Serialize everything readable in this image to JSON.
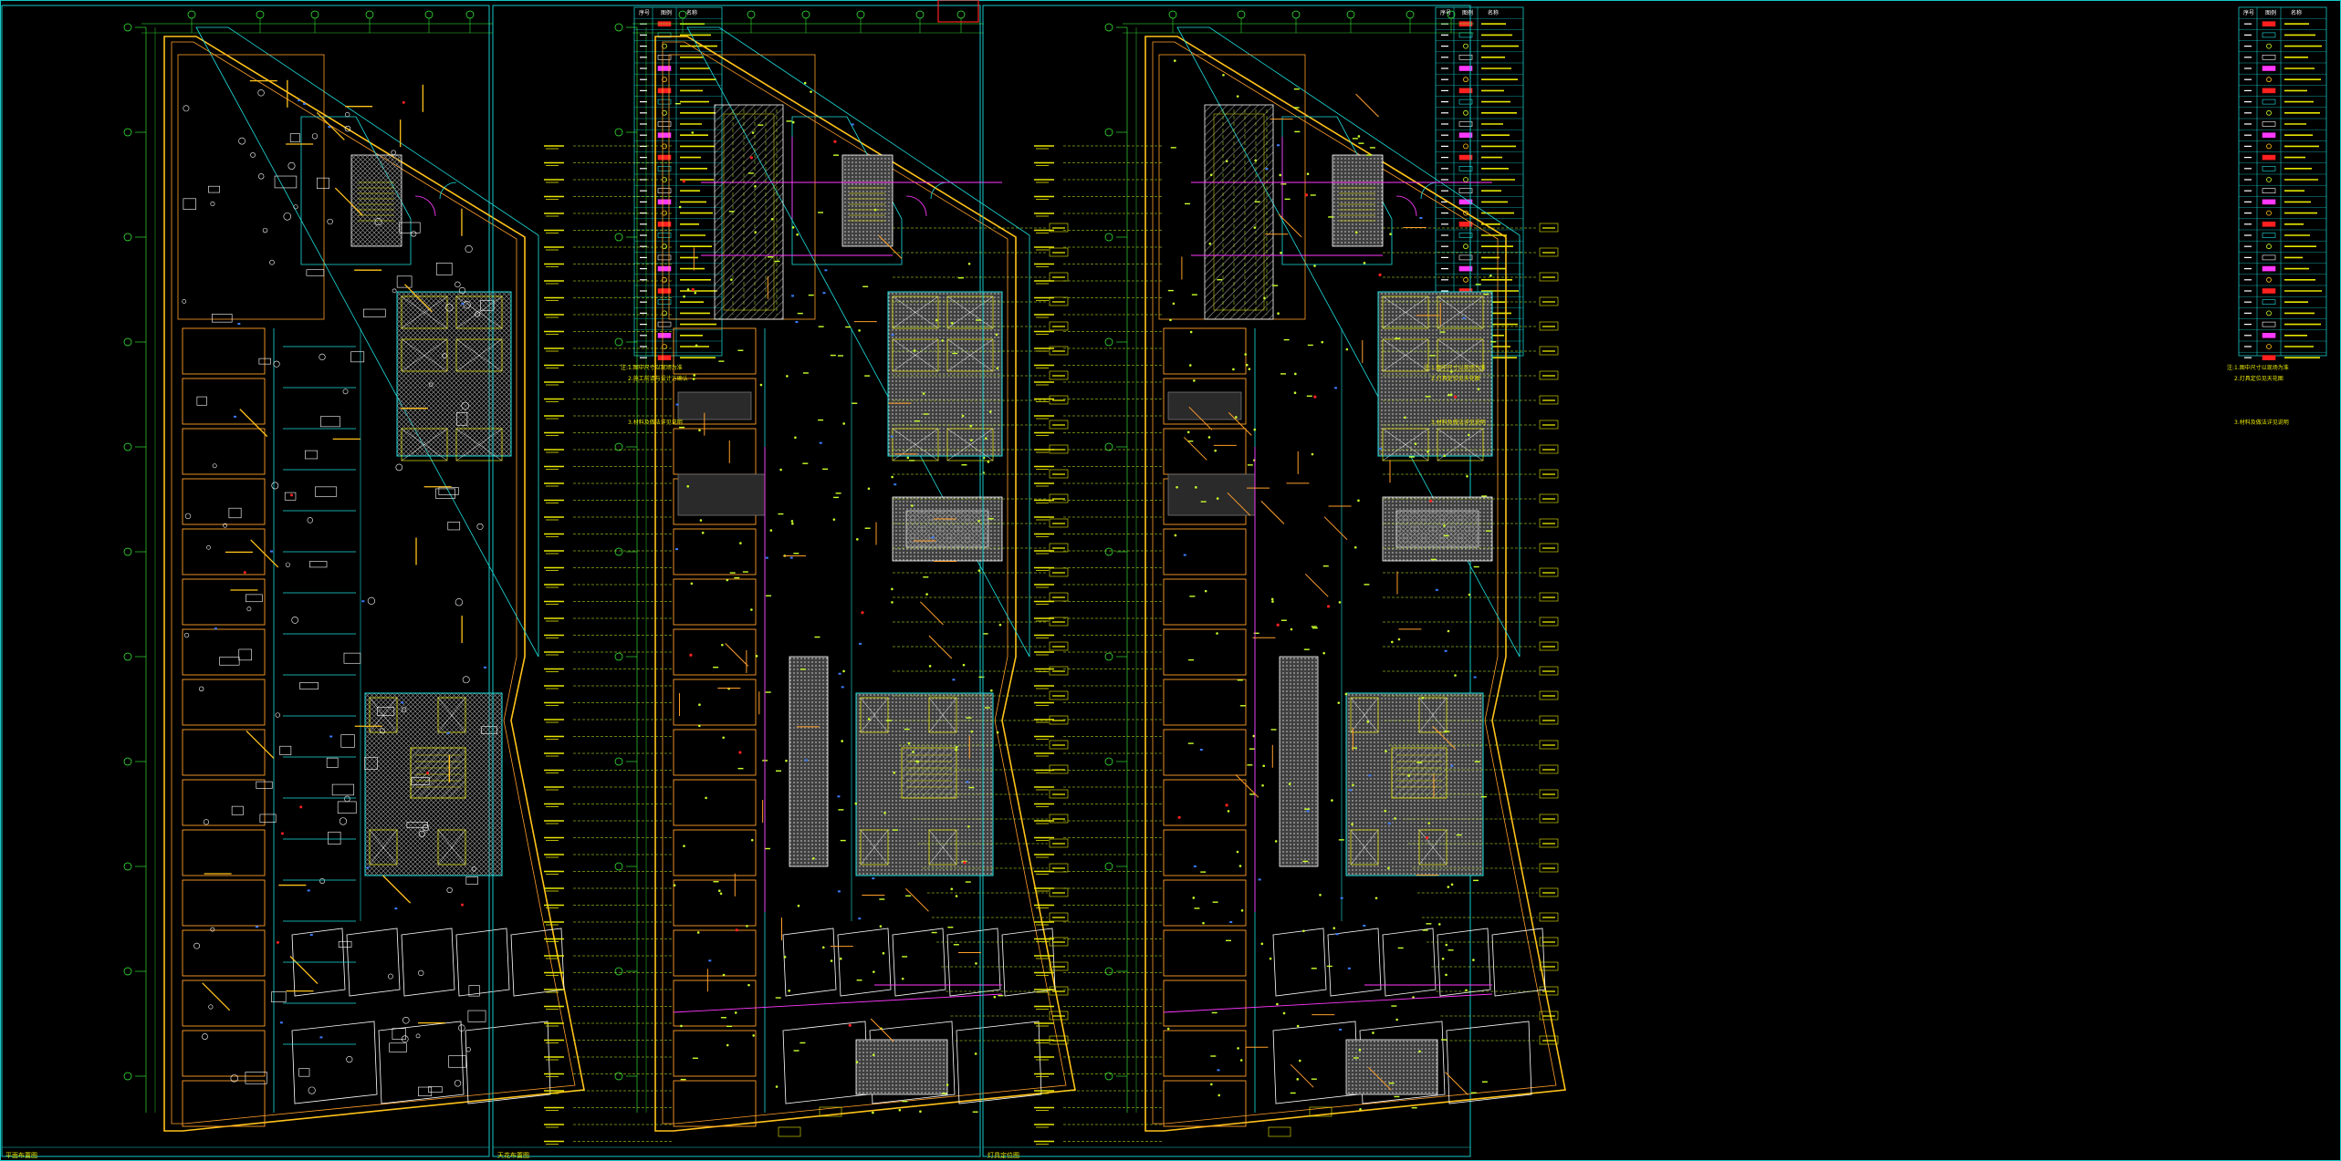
{
  "sheets": [
    {
      "id": "sheet-1",
      "title": "平面布置图",
      "legend": {
        "headers": [
          "序号",
          "图例",
          "名称"
        ],
        "row_count": 31
      },
      "notes": [
        "注:1.图中尺寸以现场为准",
        "2.施工前请与设计方确认",
        "3.材料及做法详见说明"
      ]
    },
    {
      "id": "sheet-2",
      "title": "天花布置图",
      "legend": {
        "headers": [
          "序号",
          "图例",
          "名称"
        ],
        "row_count": 31
      },
      "notes": [
        "注:1.图中尺寸以现场为准",
        "2.灯具定位见天花图",
        "3.材料及做法详见说明"
      ]
    },
    {
      "id": "sheet-3",
      "title": "灯具定位图",
      "legend": {
        "headers": [
          "序号",
          "图例",
          "名称"
        ],
        "row_count": 31
      },
      "notes": [
        "注:1.图中尺寸以现场为准",
        "2.灯具定位见天花图",
        "3.材料及做法详见说明"
      ]
    }
  ],
  "colors": {
    "background": "#000000",
    "frame": "#16c8c8",
    "wall": "#ffc21a",
    "partition": "#ff9e2a",
    "furniture": "#ffffff",
    "glass": "#1ee0e0",
    "hatch": "#9a9a9a",
    "annotation": "#e6e600",
    "lighting": "#c8ff2a",
    "magenta": "#ff38ff",
    "axis": "#3cff3c",
    "red": "#ff2020",
    "blue": "#3c7cff"
  },
  "icons": {
    "door-swing": "door-arc-icon",
    "stair": "stair-icon",
    "elevator": "elevator-x-icon",
    "axis-bubble": "grid-axis-bubble-icon"
  }
}
